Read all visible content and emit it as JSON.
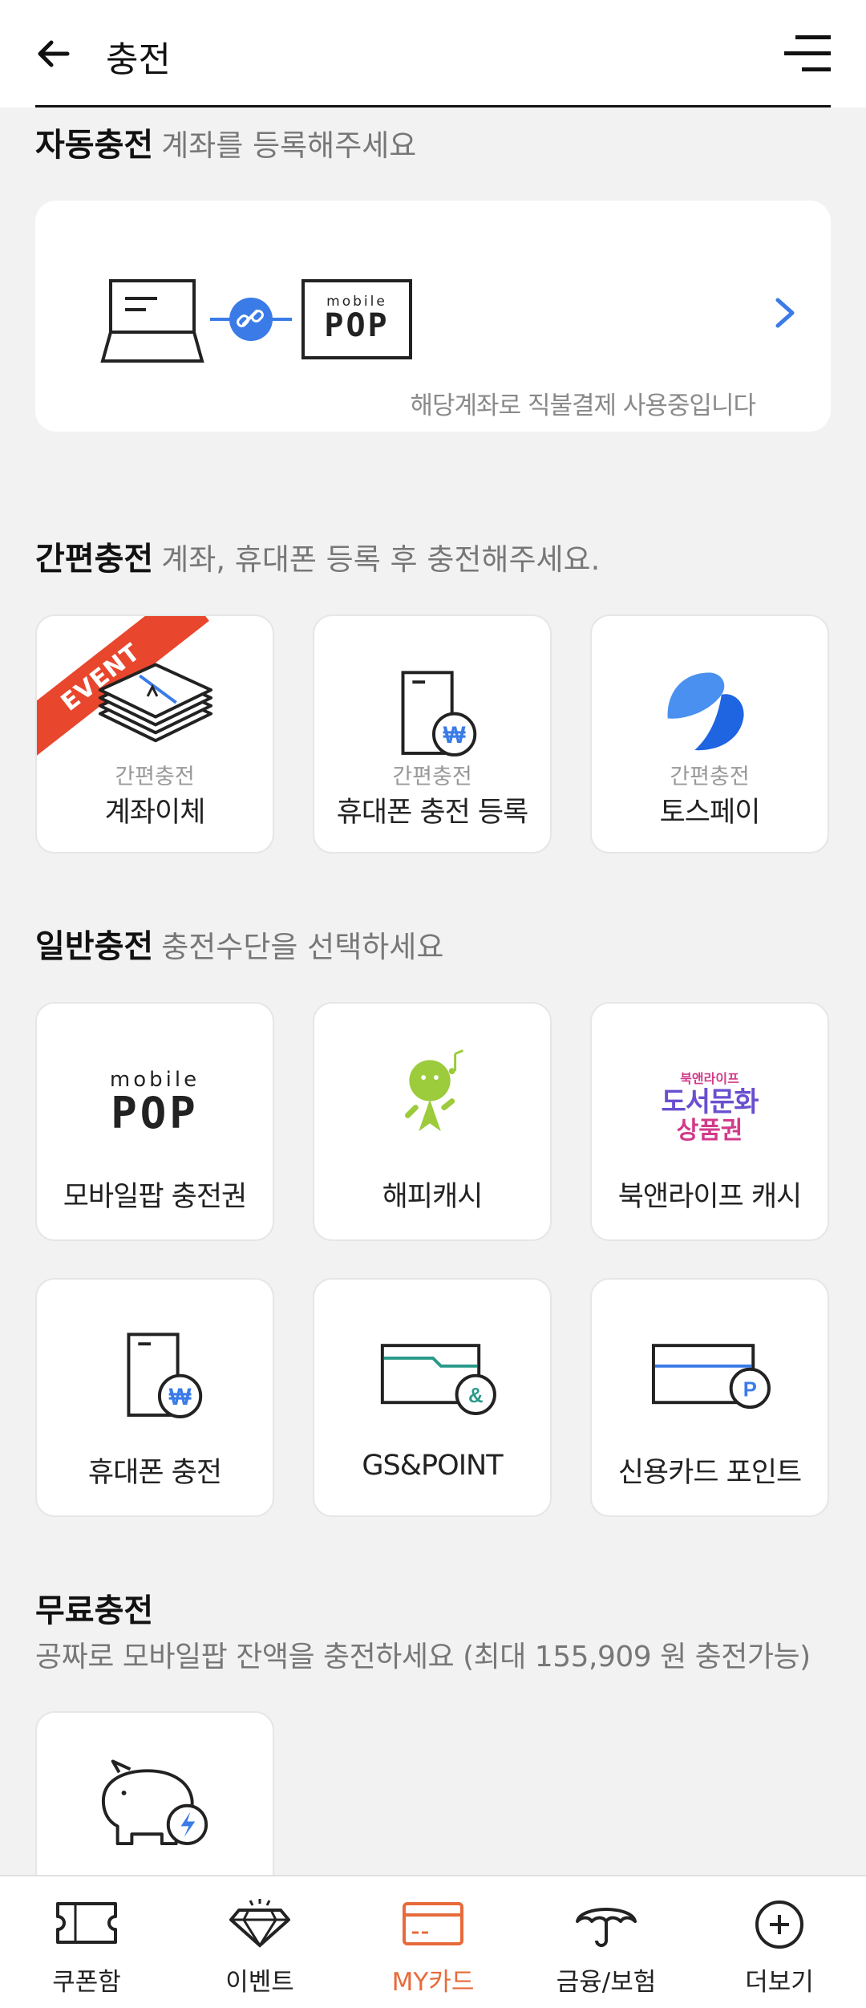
{
  "header": {
    "title": "충전",
    "back_icon": "arrow-left-icon",
    "menu_icon": "menu-icon"
  },
  "auto_charge": {
    "title": "자동충전",
    "subtitle": "계좌를 등록해주세요",
    "card_note": "해당계좌로 직불결제 사용중입니다",
    "pop_logo_small": "mobile",
    "pop_logo_big": "POP"
  },
  "easy_charge": {
    "title": "간편충전",
    "subtitle": "계좌, 휴대폰 등록 후 충전해주세요.",
    "event_ribbon": "EVENT",
    "items": [
      {
        "sub": "간편충전",
        "label": "계좌이체",
        "icon": "money-stack-icon"
      },
      {
        "sub": "간편충전",
        "label": "휴대폰 충전 등록",
        "icon": "phone-won-icon"
      },
      {
        "sub": "간편충전",
        "label": "토스페이",
        "icon": "toss-logo-icon"
      }
    ]
  },
  "general_charge": {
    "title": "일반충전",
    "subtitle": "충전수단을 선택하세요",
    "items": [
      {
        "label": "모바일팝 충전권",
        "icon": "mobile-pop-logo"
      },
      {
        "label": "해피캐시",
        "icon": "happycash-character-icon"
      },
      {
        "label": "북앤라이프 캐시",
        "icon": "book-culture-voucher-logo"
      },
      {
        "label": "휴대폰 충전",
        "icon": "phone-won-icon"
      },
      {
        "label": "GS&POINT",
        "icon": "gs-point-card-icon"
      },
      {
        "label": "신용카드 포인트",
        "icon": "credit-card-point-icon"
      }
    ],
    "bookculture_logo": {
      "top": "북앤라이프",
      "middle": "도서문화",
      "bottom": "상품권"
    }
  },
  "free_charge": {
    "title": "무료충전",
    "subtitle": "공짜로 모바일팝 잔액을 충전하세요 (최대 155,909 원 충전가능)",
    "item_icon": "piggy-bank-icon"
  },
  "bottom_nav": [
    {
      "label": "쿠폰함",
      "icon": "ticket-icon"
    },
    {
      "label": "이벤트",
      "icon": "diamond-icon"
    },
    {
      "label": "MY카드",
      "icon": "card-icon",
      "active": true
    },
    {
      "label": "금융/보험",
      "icon": "umbrella-icon"
    },
    {
      "label": "더보기",
      "icon": "plus-circle-icon"
    }
  ],
  "colors": {
    "accent_blue": "#3a7be8",
    "active_nav": "#e76a3a",
    "event_red": "#e8462d",
    "happycash_green": "#9ccb3b"
  }
}
